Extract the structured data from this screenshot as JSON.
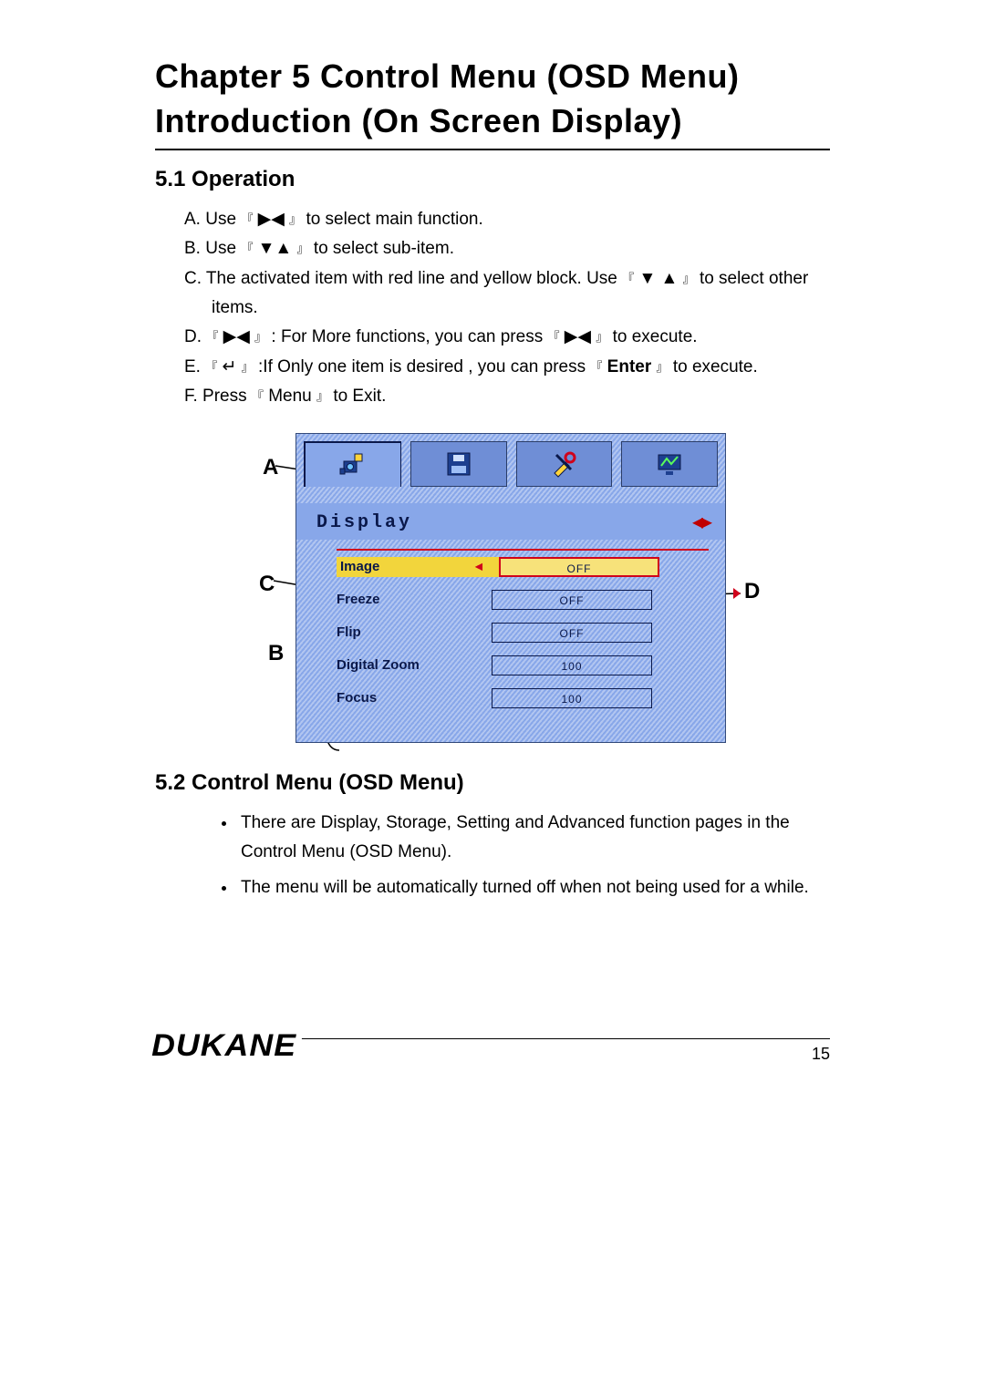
{
  "chapter_title_line1": "Chapter 5 Control Menu (OSD Menu)",
  "chapter_title_line2": "Introduction (On Screen Display)",
  "section_51": "5.1  Operation",
  "instructions": {
    "a_pre": "A. Use ",
    "a_post": " to select main function.",
    "b_pre": "B. Use ",
    "b_post": " to select sub-item.",
    "c_pre": "C. The activated item with red line and yellow block. Use",
    "c_post": "to select other items.",
    "d_pre": "D. ",
    "d_mid": " : For More functions, you can press ",
    "d_post": " to execute.",
    "e_pre": "E. ",
    "e_mid": " :If Only one item is desired , you can press ",
    "e_key": "Enter",
    "e_post": " to execute.",
    "f_pre": "F. Press ",
    "f_key": "Menu",
    "f_post": " to Exit.",
    "brak_open": "『",
    "brak_close": "』",
    "tri_right": "▶",
    "tri_left": "◀",
    "tri_down": "▼",
    "tri_up": "▲",
    "enter_sym": "↵"
  },
  "callouts": {
    "A": "A",
    "B": "B",
    "C": "C",
    "D": "D"
  },
  "osd": {
    "display_label": "Display",
    "tabs": [
      "display",
      "storage",
      "setting",
      "advanced"
    ],
    "items": [
      {
        "name": "Image",
        "value": "OFF",
        "highlight": true
      },
      {
        "name": "Freeze",
        "value": "OFF",
        "highlight": false
      },
      {
        "name": "Flip",
        "value": "OFF",
        "highlight": false
      },
      {
        "name": "Digital Zoom",
        "value": "100",
        "highlight": false
      },
      {
        "name": "Focus",
        "value": "100",
        "highlight": false
      }
    ]
  },
  "section_52": "5.2  Control Menu (OSD Menu)",
  "bullets": [
    "There are Display, Storage, Setting and Advanced function pages in the Control Menu (OSD Menu).",
    "The menu will be automatically turned off when not being used for a while."
  ],
  "brand": "DUKANE",
  "page_number": "15"
}
